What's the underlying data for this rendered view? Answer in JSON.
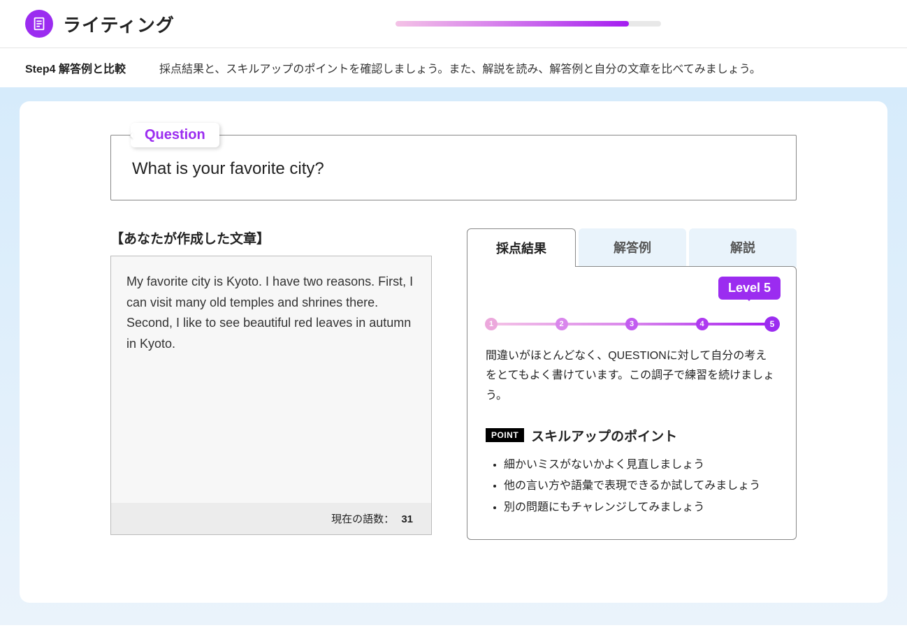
{
  "header": {
    "title": "ライティング",
    "progress_percent": 88
  },
  "subheader": {
    "step": "Step4 解答例と比較",
    "desc": "採点結果と、スキルアップのポイントを確認しましょう。また、解説を読み、解答例と自分の文章を比べてみましょう。"
  },
  "question": {
    "tag": "Question",
    "text": "What is your favorite city?"
  },
  "your_text": {
    "label": "【あなたが作成した文章】",
    "body": "My favorite city is Kyoto. I have two reasons. First, I can visit many old temples and shrines there. Second, I like to see beautiful red leaves in autumn in Kyoto.",
    "count_label": "現在の語数：",
    "count": "31"
  },
  "tabs": [
    "採点結果",
    "解答例",
    "解説"
  ],
  "active_tab": 0,
  "result": {
    "levels": [
      "1",
      "2",
      "3",
      "4",
      "5"
    ],
    "level_badge": "Level 5",
    "desc": "間違いがほとんどなく、QUESTIONに対して自分の考えをとてもよく書けています。この調子で練習を続けましょう。",
    "point_tag": "POINT",
    "point_title": "スキルアップのポイント",
    "points": [
      "細かいミスがないかよく見直しましょう",
      "他の言い方や語彙で表現できるか試してみましょう",
      "別の問題にもチャレンジしてみましょう"
    ]
  }
}
